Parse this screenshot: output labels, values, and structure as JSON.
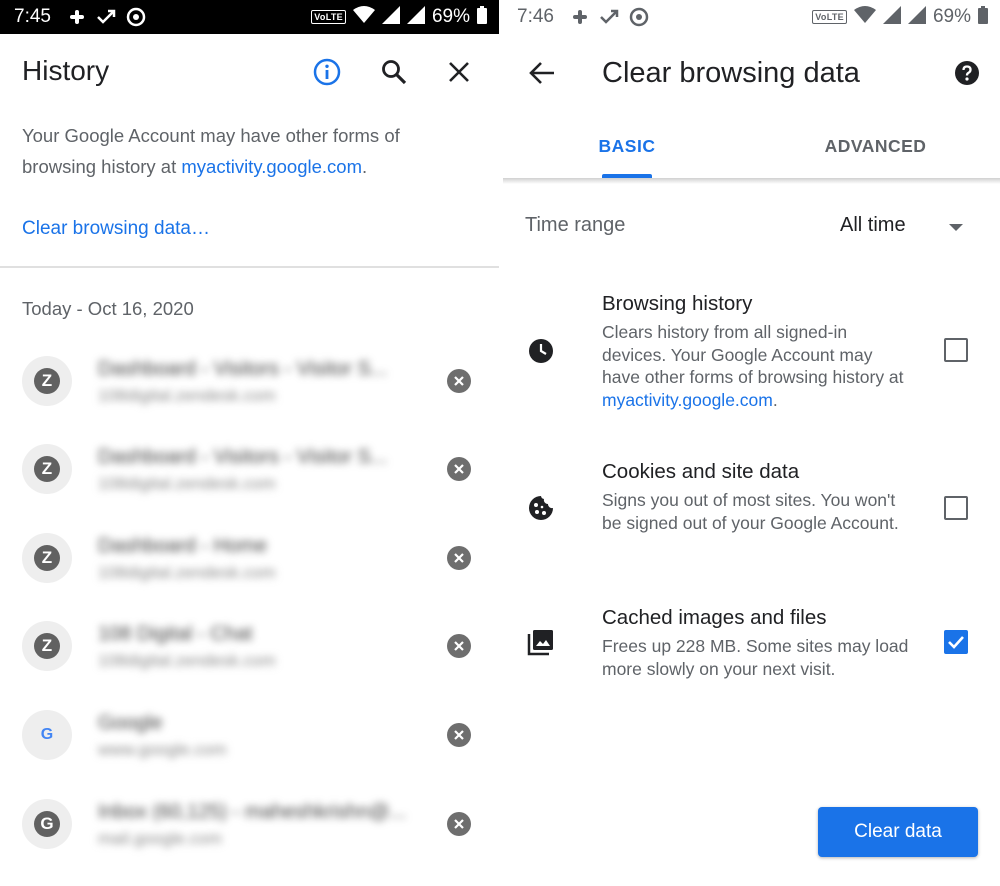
{
  "left_screen": {
    "status_bar": {
      "time": "7:45",
      "volte": "VoLTE",
      "battery": "69%"
    },
    "toolbar": {
      "title": "History"
    },
    "info": {
      "text": "Your Google Account may have other forms of browsing history at ",
      "link": "myactivity.google.com",
      "suffix": "."
    },
    "clear_link": "Clear browsing data…",
    "date_header": "Today - Oct 16, 2020",
    "items": [
      {
        "favicon": "Z",
        "title": "Dashboard - Visitors - Visitor S...",
        "url": "108digital.zendesk.com"
      },
      {
        "favicon": "Z",
        "title": "Dashboard - Visitors - Visitor S...",
        "url": "108digital.zendesk.com"
      },
      {
        "favicon": "Z",
        "title": "Dashboard - Home",
        "url": "108digital.zendesk.com"
      },
      {
        "favicon": "Z",
        "title": "108 Digital - Chat",
        "url": "108digital.zendesk.com"
      },
      {
        "favicon": "G",
        "title": "Google",
        "url": "www.google.com"
      },
      {
        "favicon": "G",
        "title": "Inbox (60,125) - maheshkrishn@...",
        "url": "mail.google.com"
      }
    ]
  },
  "right_screen": {
    "status_bar": {
      "time": "7:46",
      "volte": "VoLTE",
      "battery": "69%"
    },
    "toolbar": {
      "title": "Clear browsing data"
    },
    "tabs": [
      {
        "label": "BASIC",
        "active": true
      },
      {
        "label": "ADVANCED",
        "active": false
      }
    ],
    "time_range": {
      "label": "Time range",
      "value": "All time"
    },
    "options": [
      {
        "icon": "clock-icon",
        "title": "Browsing history",
        "description": "Clears history from all signed-in devices. Your Google Account may have other forms of browsing history at ",
        "link": "myactivity.google.com",
        "suffix": ".",
        "checked": false
      },
      {
        "icon": "cookie-icon",
        "title": "Cookies and site data",
        "description": "Signs you out of most sites. You won't be signed out of your Google Account.",
        "checked": false
      },
      {
        "icon": "image-icon",
        "title": "Cached images and files",
        "description": "Frees up 228 MB. Some sites may load more slowly on your next visit.",
        "checked": true
      }
    ],
    "clear_button": "Clear data"
  },
  "colors": {
    "accent": "#1a73e8",
    "text": "#202124",
    "secondary": "#5f6368"
  }
}
